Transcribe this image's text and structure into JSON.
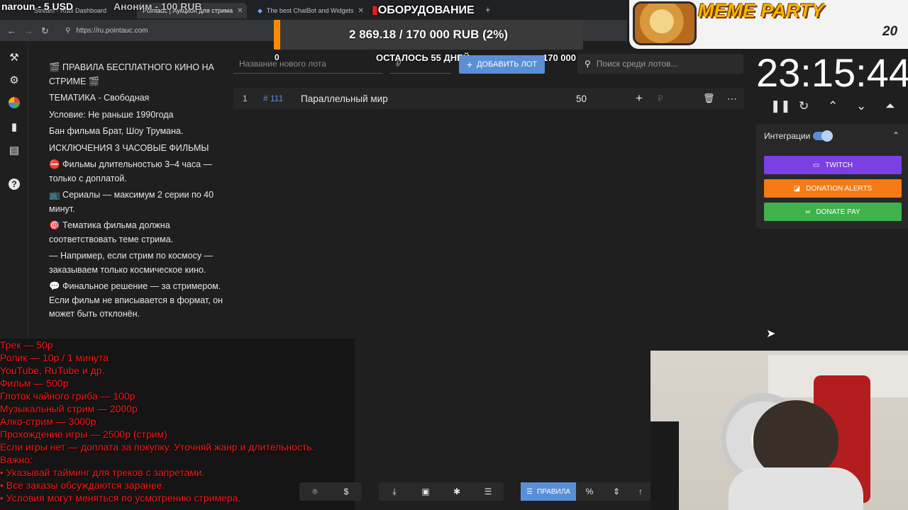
{
  "browser": {
    "tabs": [
      {
        "label": "Stream - Rubi Dashboard",
        "active": false
      },
      {
        "label": "Pointauc | Аукцион для стрима",
        "active": true
      },
      {
        "label": "The best ChatBot and Widgets",
        "active": false
      }
    ],
    "url": "https://ru.pointauc.com"
  },
  "overlays": {
    "donor_left": "naroun - 5 USD",
    "donor_mid": "Аноним - 100 RUB",
    "equipment": "ОБОРУДОВАНИЕ",
    "goal": {
      "text": "2 869.18 / 170 000 RUB (2%)",
      "progress": 0.02,
      "min": "0",
      "remaining": "ОСТАЛОСЬ 55 ДНЕЙ",
      "max": "170 000"
    },
    "meme": {
      "title": "MEME PARTY",
      "count": "20"
    }
  },
  "rules": [
    "🎬 ПРАВИЛА БЕСПЛАТНОГО КИНО НА СТРИМЕ 🎬",
    "ТЕМАТИКА - Свободная",
    "Условие:  Не раньше 1990года",
    "Бан фильма Брат, Шоу Трумана.",
    "ИСКЛЮЧЕНИЯ  3 ЧАСОВЫЕ ФИЛЬМЫ",
    "⛔ Фильмы длительностью 3–4 часа — только с доплатой.",
    "📺 Сериалы — максимум 2 серии по 40 минут.",
    "🎯 Тематика фильма должна соответствовать теме стрима.",
    "— Например, если стрим по космосу — заказываем только космическое кино.",
    "💬 Финальное решение — за стримером. Если фильм не вписывается в формат, он может быть отклонён."
  ],
  "lot_form": {
    "name_placeholder": "Название нового лота",
    "amount_placeholder": "₽",
    "add_label": "ДОБАВИТЬ ЛОТ",
    "search_placeholder": "Поиск среди лотов..."
  },
  "lots": [
    {
      "index": "1",
      "id": "# 111",
      "name": "Параллельный мир",
      "amount": "50",
      "currency": "₽"
    }
  ],
  "timer": {
    "value": "23:15:44"
  },
  "integrations": {
    "label": "Интеграции",
    "buttons": [
      {
        "label": "TWITCH",
        "color": "#7b3fe4"
      },
      {
        "label": "DONATION ALERTS",
        "color": "#f57b15"
      },
      {
        "label": "DONATE PAY",
        "color": "#3fb24c"
      }
    ]
  },
  "prices": [
    "Трек — 50р",
    " Ролик — 10р / 1 минута",
    "YouTube, RuTube и др.",
    " Фильм — 500р",
    " Глоток чайного гриба — 100р",
    "Музыкальный стрим — 2000р",
    " Алко-стрим — 3000р",
    " Прохождение игры — 2500р (стрим)",
    "Если игры нет — доплата за покупку. Уточняй жанр и длительность.",
    " Важно:",
    "• Указывай тайминг для треков с запретами.",
    "• Все заказы обсуждаются заранее.",
    "• Условия могут меняться по усмотрению стримера."
  ],
  "toolbar": {
    "rules_label": "ПРАВИЛА"
  }
}
